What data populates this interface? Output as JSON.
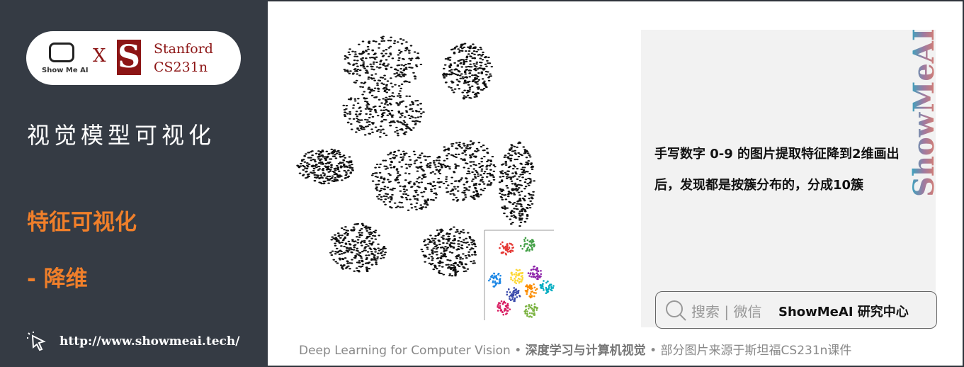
{
  "sidebar": {
    "logo": {
      "showmeai": "Show Me AI",
      "x": "X",
      "stanford_s": "S",
      "stanford_line1": "Stanford",
      "stanford_line2": "CS231n"
    },
    "title": "视觉模型可视化",
    "section": "特征可视化",
    "subsection": "- 降维",
    "url": "http://www.showmeai.tech/",
    "icon": "cursor-click-icon"
  },
  "main": {
    "figure": {
      "description": "t-SNE scatter of digit features; inset colored clusters",
      "inset_colors": [
        "#e53935",
        "#43a047",
        "#1e88e5",
        "#fdd835",
        "#8e24aa",
        "#00acc1",
        "#fb8c00",
        "#d81b60",
        "#7cb342",
        "#3949ab"
      ]
    },
    "description": "手写数字 0-9 的图片提取特征降到2维画出后，发现都是按簇分布的，分成10簇",
    "vertical_logo": "ShowMeAI",
    "search": {
      "icon": "search-icon",
      "label": "搜索 | 微信",
      "brand": "ShowMeAI 研究中心"
    }
  },
  "footer": {
    "part1": "Deep Learning for Computer Vision",
    "sep": " • ",
    "part2": "深度学习与计算机视觉",
    "part3": "部分图片来源于斯坦福CS231n课件"
  }
}
